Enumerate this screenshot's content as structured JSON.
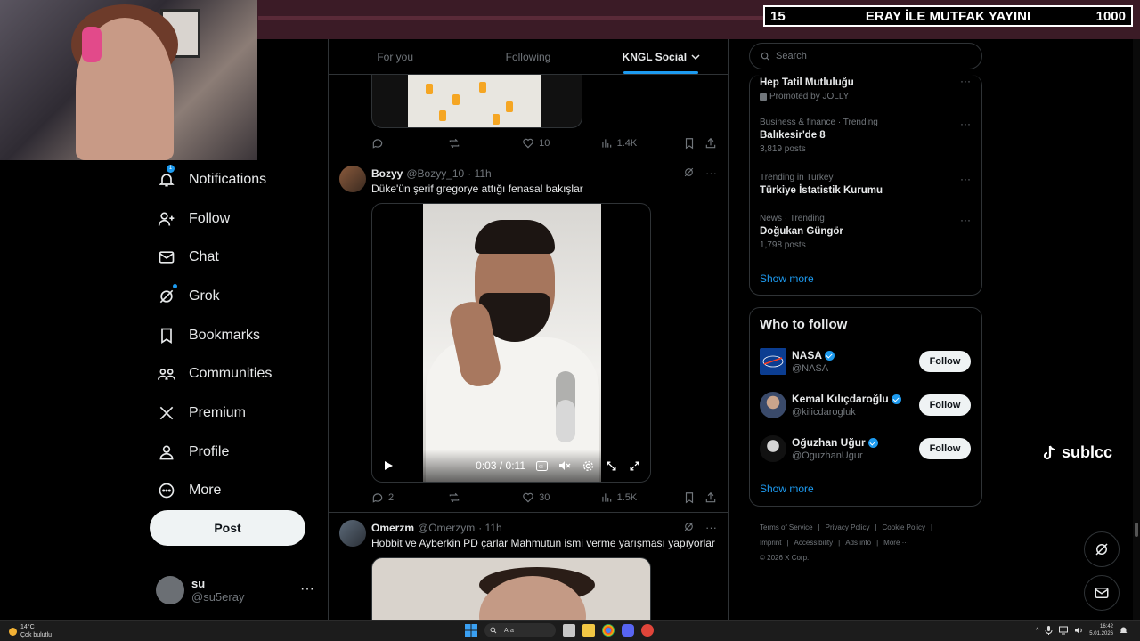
{
  "stream": {
    "left_number": "15",
    "title": "ERAY İLE MUTFAK YAYINI",
    "right_number": "1000"
  },
  "nav": {
    "items": [
      {
        "label": "Notifications",
        "icon": "bell-icon",
        "badge": "1"
      },
      {
        "label": "Follow",
        "icon": "follow-icon"
      },
      {
        "label": "Chat",
        "icon": "mail-icon"
      },
      {
        "label": "Grok",
        "icon": "grok-icon"
      },
      {
        "label": "Bookmarks",
        "icon": "bookmark-icon"
      },
      {
        "label": "Communities",
        "icon": "communities-icon"
      },
      {
        "label": "Premium",
        "icon": "x-logo-icon"
      },
      {
        "label": "Profile",
        "icon": "person-icon"
      },
      {
        "label": "More",
        "icon": "more-circle-icon"
      }
    ],
    "post_label": "Post",
    "account": {
      "name": "su",
      "handle": "@su5eray",
      "more": "···"
    }
  },
  "tabs": [
    {
      "label": "For you",
      "active": false
    },
    {
      "label": "Following",
      "active": false
    },
    {
      "label": "KNGL Social",
      "active": true
    }
  ],
  "feed": {
    "prev_tweet_actions": {
      "replies": "",
      "retweets": "",
      "likes": "10",
      "views": "1.4K"
    },
    "tweet1": {
      "name": "Bozyy",
      "handle": "@Bozyy_10",
      "time": "· 11h",
      "text": "Düke'ün şerif gregorye attığı fenasal bakışlar",
      "video_time": "0:03 / 0:11",
      "volume_level": 0.6,
      "actions": {
        "replies": "2",
        "retweets": "",
        "likes": "30",
        "views": "1.5K"
      }
    },
    "tweet2": {
      "name": "Omerzm",
      "handle": "@Omerzym",
      "time": "· 11h",
      "text": "Hobbit ve Ayberkin PD çarlar Mahmutun ismi verme yarışması yapıyorlar"
    }
  },
  "sidebar": {
    "search_placeholder": "Search",
    "trends": [
      {
        "meta": "",
        "title": "Hep Tatil Mutluluğu",
        "extra": "Promoted by JOLLY"
      },
      {
        "meta": "Business & finance · Trending",
        "title": "Balıkesir'de 8",
        "extra": "3,819 posts"
      },
      {
        "meta": "Trending in Turkey",
        "title": "Türkiye İstatistik Kurumu",
        "extra": ""
      },
      {
        "meta": "News · Trending",
        "title": "Doğukan Güngör",
        "extra": "1,798 posts"
      }
    ],
    "trends_show_more": "Show more",
    "who_to_follow_title": "Who to follow",
    "who_to_follow": [
      {
        "name": "NASA",
        "handle": "@NASA",
        "button": "Follow"
      },
      {
        "name": "Kemal Kılıçdaroğlu",
        "handle": "@kilicdarogluk",
        "button": "Follow"
      },
      {
        "name": "Oğuzhan Uğur",
        "handle": "@OguzhanUgur",
        "button": "Follow"
      }
    ],
    "wtf_show_more": "Show more",
    "footer": [
      "Terms of Service",
      "|",
      "Privacy Policy",
      "|",
      "Cookie Policy",
      "|",
      "Imprint",
      "|",
      "Accessibility",
      "|",
      "Ads info",
      "|",
      "More ···",
      "© 2026 X Corp."
    ]
  },
  "overlay": {
    "brand": "sublcc"
  },
  "taskbar": {
    "weather_temp": "14°C",
    "weather_desc": "Çok bulutlu",
    "search_label": "Ara",
    "time": "16:42",
    "date": "5.01.2026"
  }
}
